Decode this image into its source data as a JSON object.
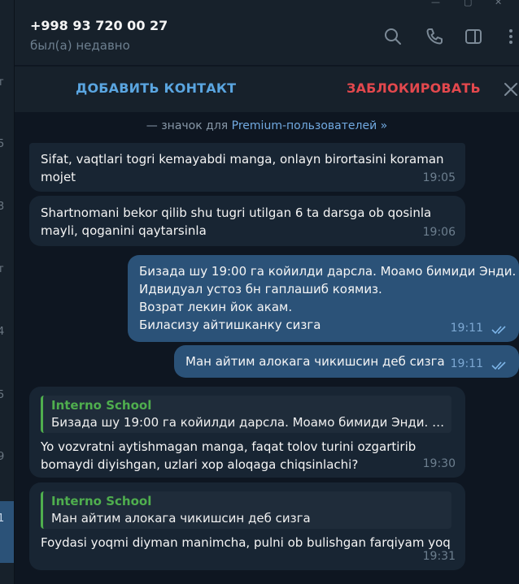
{
  "sidebar": {
    "fragments": [
      "т",
      "5",
      "3",
      "т",
      "4",
      "5",
      "9",
      "1"
    ]
  },
  "header": {
    "title": "+998 93 720 00 27",
    "status": "был(а) недавно",
    "icons": [
      "search-icon",
      "phone-icon",
      "sidebar-toggle-icon",
      "more-icon"
    ]
  },
  "actions": {
    "add_contact": "ДОБАВИТЬ КОНТАКТ",
    "block": "ЗАБЛОКИРОВАТЬ"
  },
  "premium": {
    "prefix": "— значок для",
    "link": "Premium-пользователей »"
  },
  "messages": [
    {
      "dir": "in",
      "text": "Sifat, vaqtlari togri kemayabdi manga, onlayn birortasini koraman\nmojet",
      "time": "19:05"
    },
    {
      "dir": "in",
      "text": "Shartnomani bekor qilib shu tugri utilgan 6 ta darsga ob qosinla\nmayli, qoganini qaytarsinla",
      "time": "19:06"
    },
    {
      "dir": "out",
      "text": "Бизада шу 19:00  га койилди дарсла. Моамо бимиди Энди.\nИдвидуал устоз бн гаплашиб коямиз.\nВозрат лекин йок акам.\nБиласизу айтишканку сизга",
      "time": "19:11"
    },
    {
      "dir": "out",
      "text": "Ман айтим алокага чикишсин деб сизга",
      "time": "19:11"
    },
    {
      "dir": "in",
      "reply_name": "Interno School",
      "reply_text": "Бизада шу 19:00  га койилди дарсла. Моамо бимиди Энди. И...",
      "text": "Yo vozvratni aytishmagan manga, faqat tolov turini ozgartirib\nbomaydi diyishgan, uzlari xop aloqaga chiqsinlachi?",
      "time": "19:30"
    },
    {
      "dir": "in",
      "reply_name": "Interno School",
      "reply_text": "Ман айтим алокага чикишсин деб сизга",
      "text": "Foydasi yoqmi diyman manimcha, pulni ob bulishgan farqiyam yoq",
      "time": "19:31"
    }
  ],
  "colors": {
    "background": "#0e1621",
    "panel": "#17212b",
    "incoming_bubble": "#182533",
    "outgoing_bubble": "#2b5278",
    "accent_blue": "#5aa5e0",
    "danger_red": "#e3484d",
    "reply_green": "#4fae4e"
  }
}
